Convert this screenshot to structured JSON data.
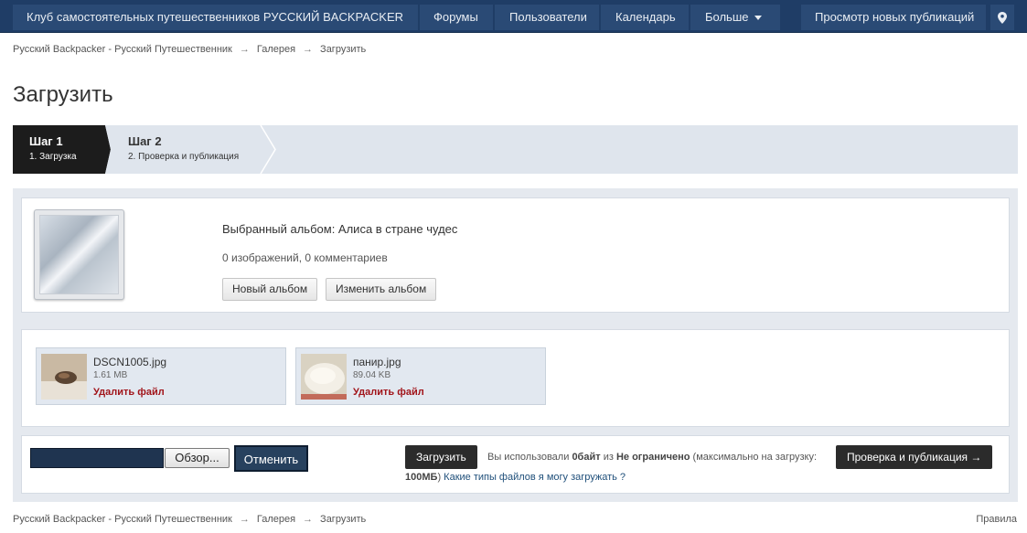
{
  "nav": {
    "brand": "Клуб самостоятельных путешественников РУССКИЙ BACKPACKER",
    "items": [
      "Форумы",
      "Пользователи",
      "Календарь",
      "Больше"
    ],
    "right_item": "Просмотр новых публикаций",
    "pin_icon": "map-pin-icon"
  },
  "breadcrumb": {
    "items": [
      "Русский Backpacker - Русский Путешественник",
      "Галерея",
      "Загрузить"
    ],
    "separator": "→"
  },
  "page_title": "Загрузить",
  "steps": [
    {
      "title": "Шаг 1",
      "subtitle": "1. Загрузка"
    },
    {
      "title": "Шаг 2",
      "subtitle": "2. Проверка и публикация"
    }
  ],
  "album": {
    "selected": "Выбранный альбом: Алиса в стране чудес",
    "stats": "0 изображений, 0 комментариев",
    "new_button": "Новый альбом",
    "change_button": "Изменить альбом"
  },
  "files": [
    {
      "name": "DSCN1005.jpg",
      "size": "1.61 MB",
      "delete_label": "Удалить файл"
    },
    {
      "name": "панир.jpg",
      "size": "89.04 KB",
      "delete_label": "Удалить файл"
    }
  ],
  "upload": {
    "browse_label": "Обзор...",
    "cancel_label": "Отменить",
    "upload_label": "Загрузить",
    "quota_prefix": "Вы использовали",
    "used": "0байт",
    "of": "из",
    "limit": "Не ограничено",
    "max_text": "(максимально на загрузку:",
    "max_value": "100МБ",
    "max_close": ")",
    "help_link": "Какие типы файлов я могу загружать ?",
    "publish_label": "Проверка и публикация →"
  },
  "footer": {
    "rules": "Правила"
  },
  "colors": {
    "nav_bg": "#1f3d66",
    "active_step": "#1c1c1c",
    "delete_red": "#a1141a"
  }
}
